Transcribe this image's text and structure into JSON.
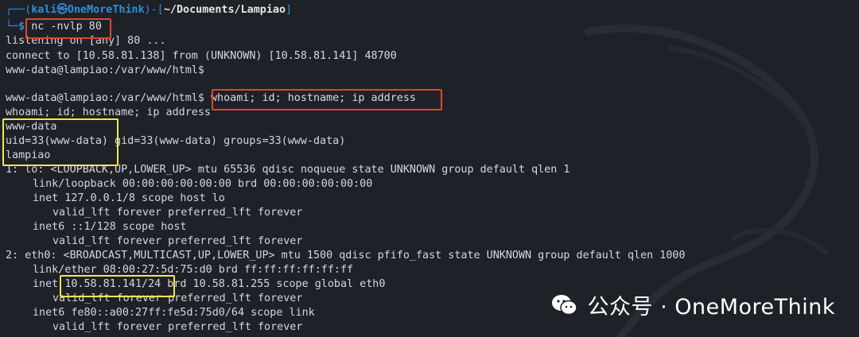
{
  "terminal": {
    "prompt": {
      "top_left": "┌──(",
      "user": "kali",
      "at": "㉿",
      "host": "OneMoreThink",
      "mid": ")-[",
      "path": "~/Documents/Lampiao",
      "end": "]",
      "bottom_left": "└─",
      "dollar": "$",
      "command": "nc -nvlp 80"
    },
    "lines": [
      "listening on [any] 80 ...",
      "connect to [10.58.81.138] from (UNKNOWN) [10.58.81.141] 48700",
      "www-data@lampiao:/var/www/html$",
      "",
      "www-data@lampiao:/var/www/html$ ",
      "whoami; id; hostname; ip address",
      "www-data",
      "uid=33(www-data) gid=33(www-data) groups=33(www-data)",
      "lampiao",
      "1: lo: <LOOPBACK,UP,LOWER_UP> mtu 65536 qdisc noqueue state UNKNOWN group default qlen 1",
      "link/loopback 00:00:00:00:00:00 brd 00:00:00:00:00:00",
      "inet 127.0.0.1/8 scope host lo",
      "valid_lft forever preferred_lft forever",
      "inet6 ::1/128 scope host",
      "valid_lft forever preferred_lft forever",
      "2: eth0: <BROADCAST,MULTICAST,UP,LOWER_UP> mtu 1500 qdisc pfifo_fast state UNKNOWN group default qlen 1000",
      "link/ether 08:00:27:5d:75:d0 brd ff:ff:ff:ff:ff:ff",
      "inet ",
      "10.58.81.141/24",
      " brd 10.58.81.255 scope global eth0",
      "valid_lft forever preferred_lft forever",
      "inet6 fe80::a00:27ff:fe5d:75d0/64 scope link",
      "valid_lft forever preferred_lft forever"
    ],
    "typed_command": "whoami; id; hostname; ip address"
  },
  "watermark": {
    "text": "公众号 · OneMoreThink",
    "icon": "wechat-icon"
  },
  "colors": {
    "background": "#1e2127",
    "prompt_blue": "#2e8fd6",
    "highlight_red": "#e0452f",
    "highlight_yellow": "#f2e84a"
  }
}
